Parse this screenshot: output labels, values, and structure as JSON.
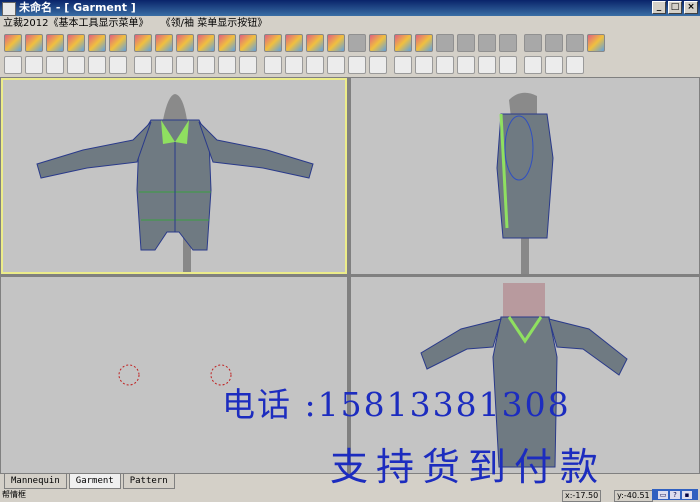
{
  "window": {
    "title": "未命名 - [ Garment ]"
  },
  "menu": {
    "items": [
      "立裁2012《基本工具显示菜单》",
      "《领/袖 菜单显示按钮》"
    ]
  },
  "toolbar1": {
    "icons": [
      "arrow-icon",
      "mannequin-icon",
      "grid-icon",
      "garment-icon",
      "shirt-icon",
      "cross-icon",
      "arrow-icon",
      "color-icon",
      "fill-icon",
      "mannequin-icon",
      "shirt-icon",
      "collar-icon",
      "sleeve-icon",
      "pocket-icon",
      "button-icon",
      "mannequin-icon",
      "blank-icon",
      "fill-icon",
      "color-icon",
      "mannequin-icon",
      "blank-icon",
      "blank-icon",
      "blank-icon",
      "blank-icon",
      "blank-icon",
      "blank-icon",
      "blank-icon",
      "grid-icon"
    ]
  },
  "toolbar2": {
    "icons": [
      "new-file-icon",
      "open-icon",
      "save-icon",
      "print-icon",
      "undo-icon",
      "redo-icon",
      "mannequin-icon",
      "view-icon",
      "shirt-icon",
      "rotate-icon",
      "pan-icon",
      "zoom-icon",
      "zoom-fit-icon",
      "move-icon",
      "align-icon",
      "ruler-icon",
      "curve-icon",
      "line-icon",
      "cross-icon",
      "node-icon",
      "view-front-icon",
      "view-back-icon",
      "view-left-icon",
      "view-right-icon",
      "view-top-icon",
      "view-bottom-icon",
      "tool-icon"
    ]
  },
  "tabs": [
    "Mannequin",
    "Garment",
    "Pattern"
  ],
  "active_tab": "Garment",
  "status": {
    "left": "帮情框",
    "x": "x:-17.50",
    "y": "y:-40.51"
  },
  "watermark": {
    "line1": "电话 :15813381308",
    "line2": "支持货到付款"
  },
  "colors": {
    "titlebar": "#0a246a",
    "active_border": "#ecec8a",
    "watermark": "#1c2cbf",
    "garment": "#6f7a82"
  }
}
